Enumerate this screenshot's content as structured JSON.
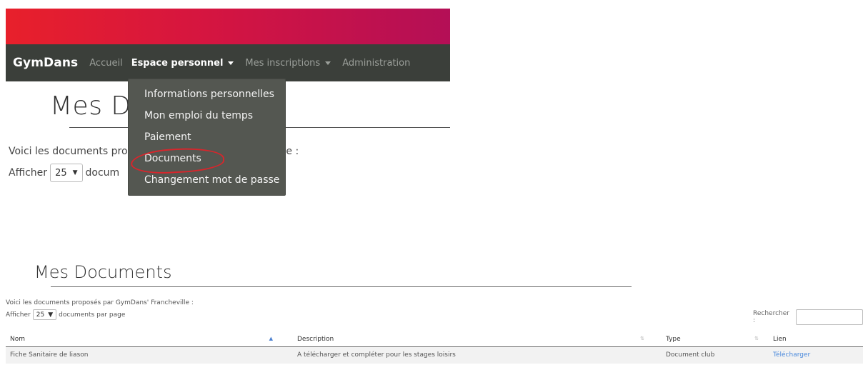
{
  "navbar": {
    "brand": "GymDans",
    "items": [
      {
        "label": "Accueil"
      },
      {
        "label": "Espace personnel"
      },
      {
        "label": "Mes inscriptions"
      },
      {
        "label": "Administration"
      }
    ]
  },
  "dropdown": {
    "items": [
      {
        "label": "Informations personnelles"
      },
      {
        "label": "Mon emploi du temps"
      },
      {
        "label": "Paiement"
      },
      {
        "label": "Documents"
      },
      {
        "label": "Changement mot de passe"
      }
    ]
  },
  "top": {
    "title": "Mes Documents",
    "title_visible": "Mes Do",
    "intro_left": "Voici les documents pro",
    "intro_right": "le :",
    "show_prefix": "Afficher",
    "show_value": "25",
    "show_suffix_visible": "docum"
  },
  "bottom": {
    "title": "Mes Documents",
    "intro": "Voici les documents proposés par GymDans' Francheville :",
    "show_prefix": "Afficher",
    "show_value": "25",
    "show_suffix": "documents par page",
    "search_label": "Rechercher :",
    "table": {
      "headers": [
        "Nom",
        "Description",
        "Type",
        "Lien"
      ],
      "rows": [
        {
          "nom": "Fiche Sanitaire de liason",
          "description": "A télécharger et compléter pour les stages loisirs",
          "type": "Document club",
          "lien": "Télécharger"
        }
      ]
    }
  },
  "colors": {
    "gradient_start": "#e8202b",
    "gradient_end": "#b40f56",
    "navbar_bg": "#3b3f3a",
    "dropdown_bg": "#545751",
    "annotation_circle": "#d7262c",
    "link": "#4a89dc"
  }
}
